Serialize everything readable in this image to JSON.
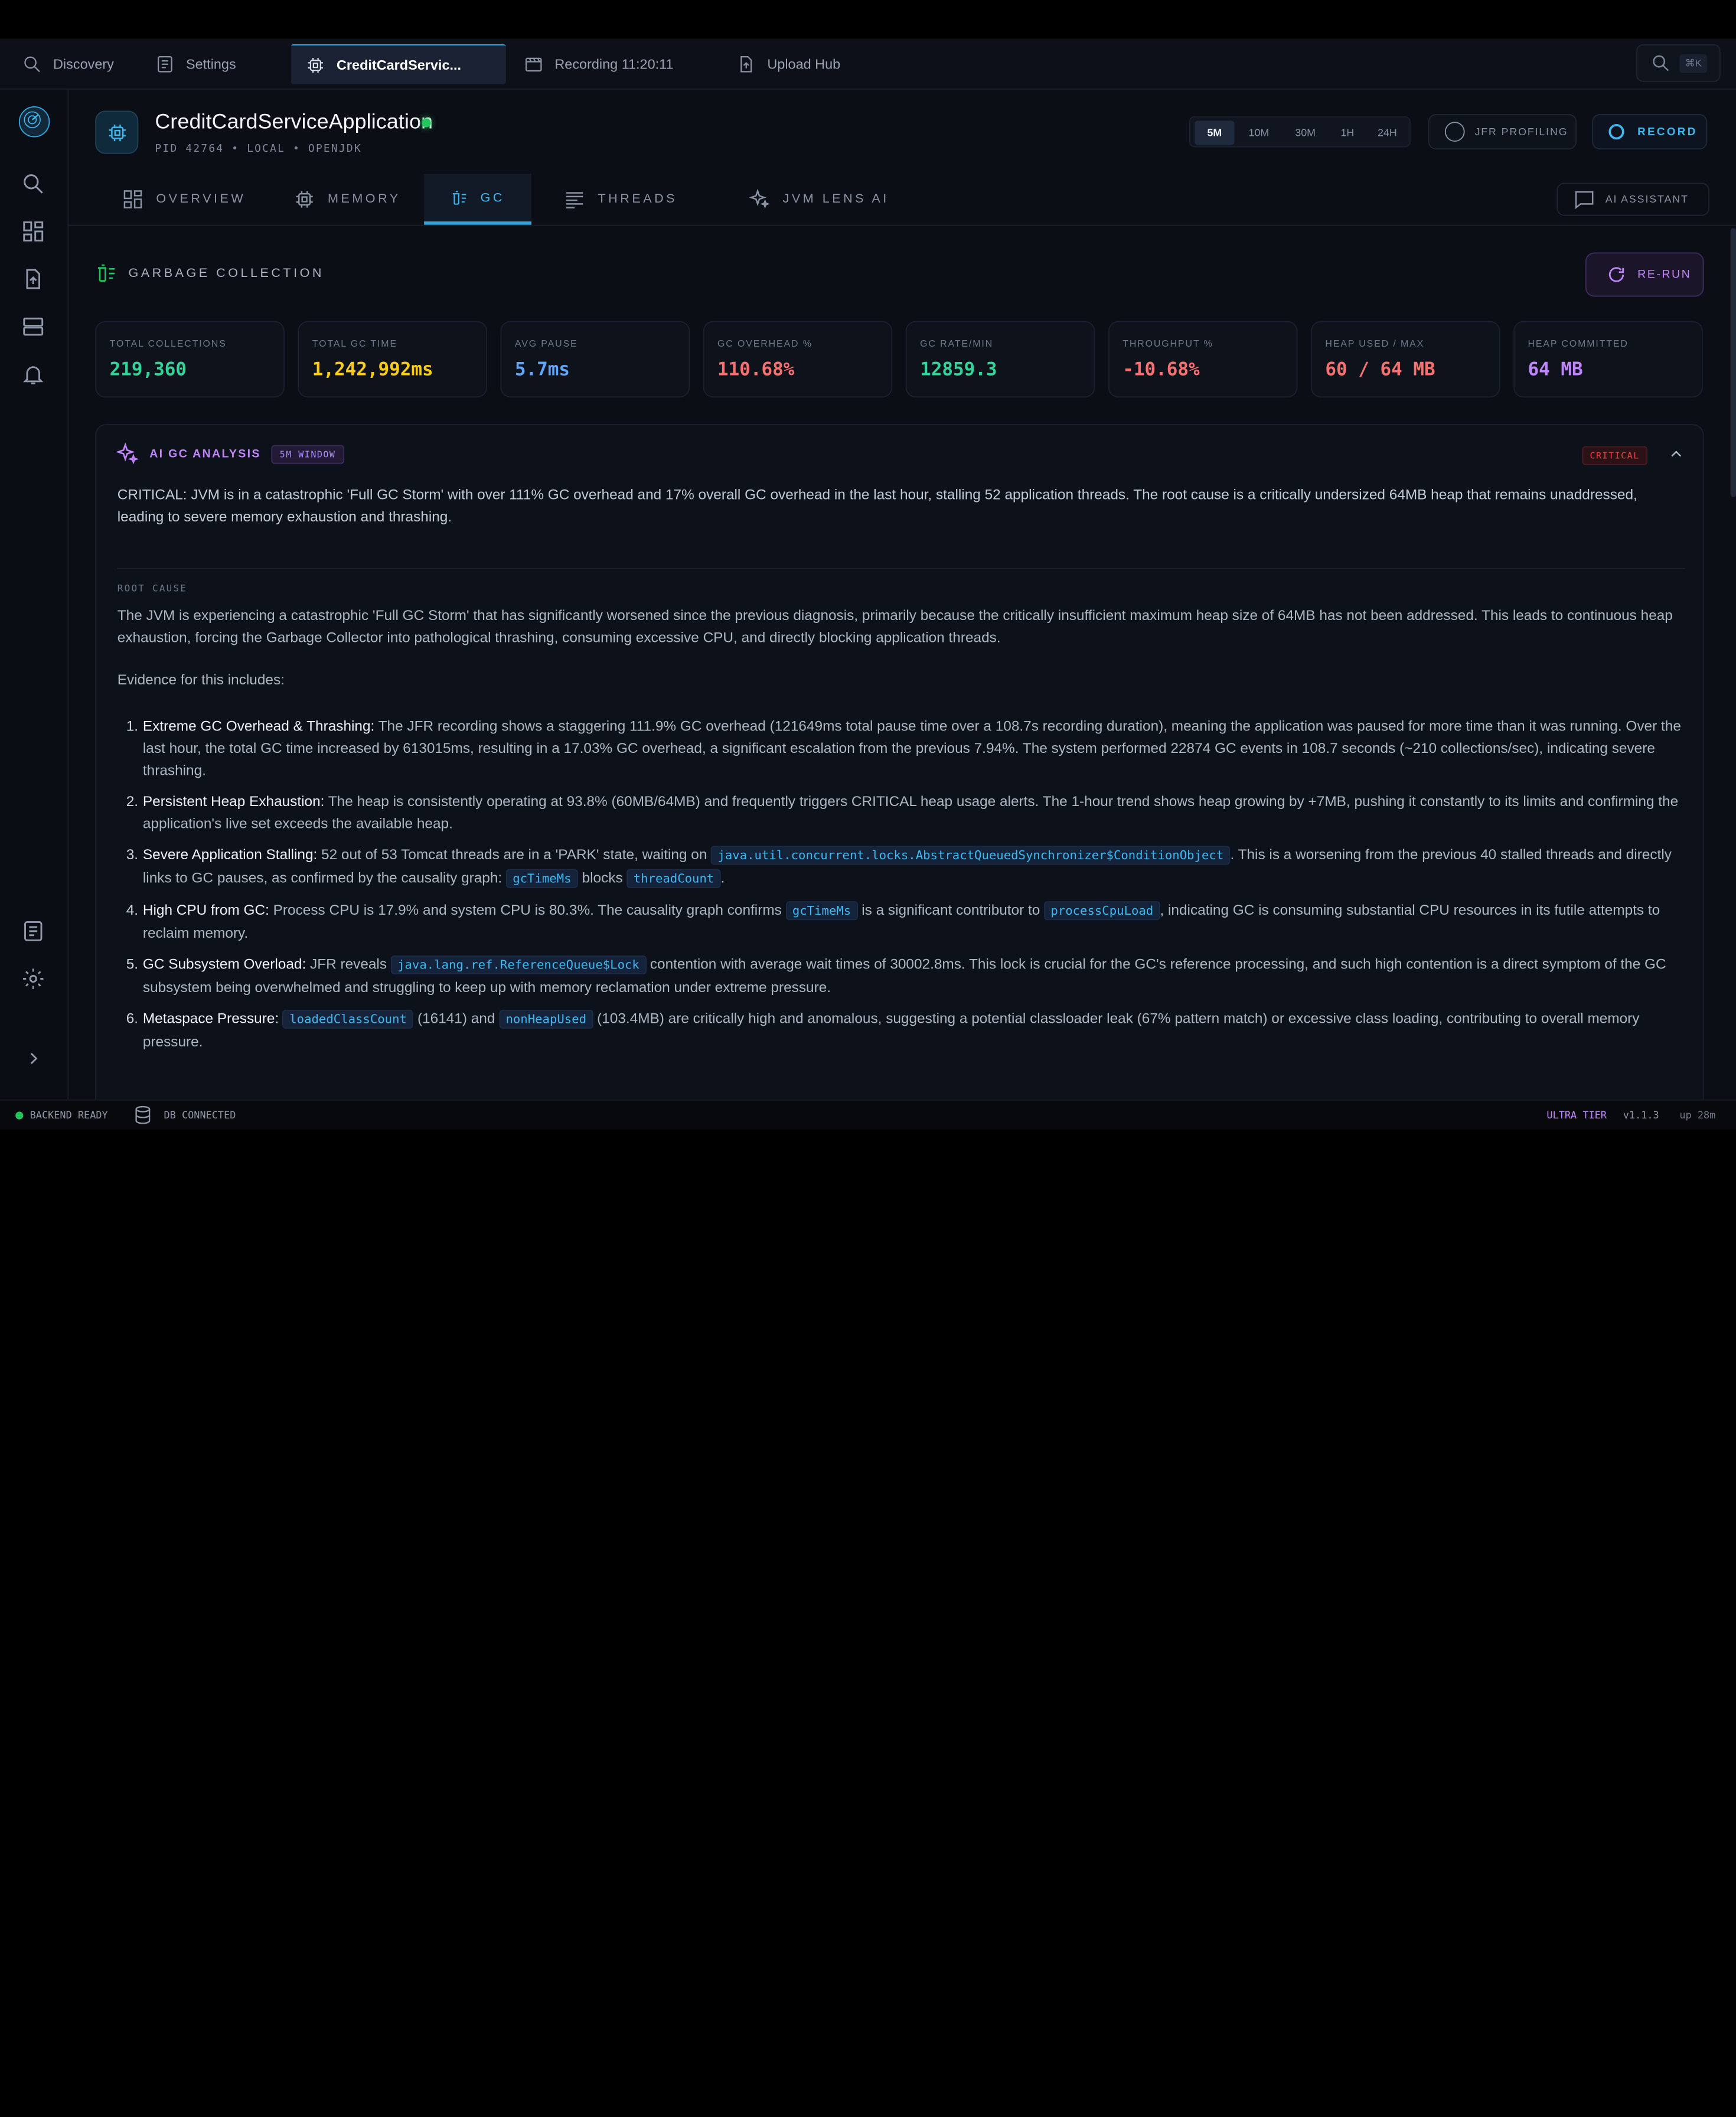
{
  "tabs": [
    {
      "label": "Discovery"
    },
    {
      "label": "Settings"
    },
    {
      "label": "CreditCardServic..."
    },
    {
      "label": "Recording 11:20:11"
    },
    {
      "label": "Upload Hub"
    }
  ],
  "search_shortcut": "⌘K",
  "app": {
    "title": "CreditCardServiceApplication",
    "meta": "PID 42764 • LOCAL • OPENJDK",
    "status_color": "#22c55e"
  },
  "time_ranges": [
    "5M",
    "10M",
    "30M",
    "1H",
    "24H"
  ],
  "selected_range": "5M",
  "jfr_label": "JFR PROFILING",
  "record_label": "RECORD",
  "section_tabs": [
    {
      "label": "OVERVIEW"
    },
    {
      "label": "MEMORY"
    },
    {
      "label": "GC"
    },
    {
      "label": "THREADS"
    },
    {
      "label": "JVM LENS AI"
    }
  ],
  "ai_assistant_label": "AI ASSISTANT",
  "gc": {
    "title": "GARBAGE COLLECTION",
    "rerun_label": "RE-RUN",
    "stats": [
      {
        "label": "TOTAL COLLECTIONS",
        "value": "219,360",
        "color": "#34d399"
      },
      {
        "label": "TOTAL GC TIME",
        "value": "1,242,992ms",
        "color": "#facc15"
      },
      {
        "label": "AVG PAUSE",
        "value": "5.7ms",
        "color": "#60a5fa"
      },
      {
        "label": "GC OVERHEAD %",
        "value": "110.68%",
        "color": "#f87171"
      },
      {
        "label": "GC RATE/MIN",
        "value": "12859.3",
        "color": "#34d399"
      },
      {
        "label": "THROUGHPUT %",
        "value": "-10.68%",
        "color": "#f87171"
      },
      {
        "label": "HEAP USED / MAX",
        "value": "60 / 64 MB",
        "color": "#f87171"
      },
      {
        "label": "HEAP COMMITTED",
        "value": "64 MB",
        "color": "#c084fc"
      }
    ]
  },
  "ai_analysis": {
    "title": "AI GC ANALYSIS",
    "window_badge": "5M WINDOW",
    "severity": "CRITICAL",
    "summary": "CRITICAL: JVM is in a catastrophic 'Full GC Storm' with over 111% GC overhead and 17% overall GC overhead in the last hour, stalling 52 application threads. The root cause is a critically undersized 64MB heap that remains unaddressed, leading to severe memory exhaustion and thrashing.",
    "root_cause_label": "ROOT CAUSE",
    "root_cause": "The JVM is experiencing a catastrophic 'Full GC Storm' that has significantly worsened since the previous diagnosis, primarily because the critically insufficient maximum heap size of 64MB has not been addressed. This leads to continuous heap exhaustion, forcing the Garbage Collector into pathological thrashing, consuming excessive CPU, and directly blocking application threads.",
    "evidence_intro": "Evidence for this includes:",
    "evidence": [
      {
        "num": "1.",
        "title": "Extreme GC Overhead & Thrashing:",
        "text": " The JFR recording shows a staggering 111.9% GC overhead (121649ms total pause time over a 108.7s recording duration), meaning the application was paused for more time than it was running. Over the last hour, the total GC time increased by 613015ms, resulting in a 17.03% GC overhead, a significant escalation from the previous 7.94%. The system performed 22874 GC events in 108.7 seconds (~210 collections/sec), indicating severe thrashing."
      },
      {
        "num": "2.",
        "title": "Persistent Heap Exhaustion:",
        "text": " The heap is consistently operating at 93.8% (60MB/64MB) and frequently triggers CRITICAL heap usage alerts. The 1-hour trend shows heap growing by +7MB, pushing it constantly to its limits and confirming the application's live set exceeds the available heap."
      },
      {
        "num": "3.",
        "title": "Severe Application Stalling:",
        "t1": " 52 out of 53 Tomcat threads are in a 'PARK' state, waiting on ",
        "c1": "java.util.concurrent.locks.AbstractQueuedSynchronizer$ConditionObject",
        "t2": ". This is a worsening from the previous 40 stalled threads and directly links to GC pauses, as confirmed by the causality graph: ",
        "c2": "gcTimeMs",
        "t3": " blocks ",
        "c3": "threadCount",
        "t4": "."
      },
      {
        "num": "4.",
        "title": "High CPU from GC:",
        "t1": " Process CPU is 17.9% and system CPU is 80.3%. The causality graph confirms ",
        "c1": "gcTimeMs",
        "t2": " is a significant contributor to ",
        "c2": "processCpuLoad",
        "t3": ", indicating GC is consuming substantial CPU resources in its futile attempts to reclaim memory."
      },
      {
        "num": "5.",
        "title": "GC Subsystem Overload:",
        "t1": " JFR reveals ",
        "c1": "java.lang.ref.ReferenceQueue$Lock",
        "t2": " contention with average wait times of 30002.8ms. This lock is crucial for the GC's reference processing, and such high contention is a direct symptom of the GC subsystem being overwhelmed and struggling to keep up with memory reclamation under extreme pressure."
      },
      {
        "num": "6.",
        "title": "Metaspace Pressure:",
        "t1": " ",
        "c1": "loadedClassCount",
        "t2": " (16141) and ",
        "c2": "nonHeapUsed",
        "t3": " (103.4MB) are critically high and anomalous, suggesting a potential classloader leak (67% pattern match) or excessive class loading, contributing to overall memory pressure."
      }
    ]
  },
  "statusbar": {
    "backend": "BACKEND READY",
    "db": "DB CONNECTED",
    "tier": "ULTRA TIER",
    "version": "v1.1.3",
    "uptime": "up 28m"
  }
}
